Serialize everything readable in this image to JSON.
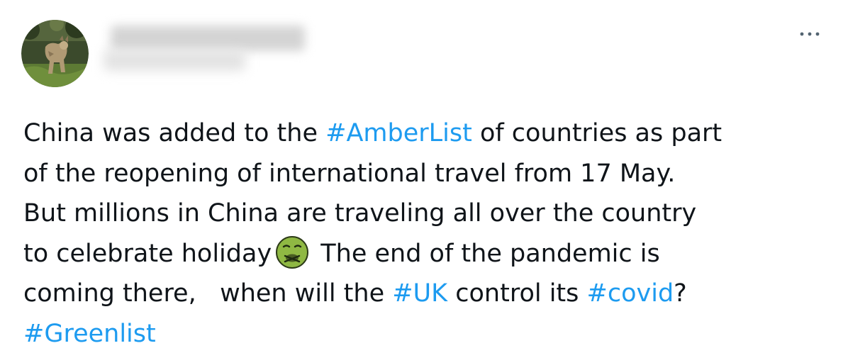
{
  "tweet": {
    "avatar": {
      "icon": "wildcat-photo-avatar",
      "blurred": false
    },
    "author": {
      "redacted": true
    },
    "more_icon": "more-horizontal-icon",
    "accent_color": "#1d9bf0",
    "text_color": "#0f1419",
    "body": {
      "l1_a": "China was added to the ",
      "l1_tag": "#AmberList",
      "l1_b": " of countries as part",
      "l2": "of the reopening of international travel from 17 May.",
      "l3": "But millions in China are traveling all over the country",
      "l4_a": "to celebrate holiday",
      "l4_emoji": "nauseated-face-emoji",
      "l4_b": " The end of the pandemic is",
      "l5_a": "coming there,   when will the ",
      "l5_tag1": "#UK",
      "l5_b": " control its ",
      "l5_tag2": "#covid",
      "l5_c": "?",
      "l6_tag": "#Greenlist"
    }
  }
}
